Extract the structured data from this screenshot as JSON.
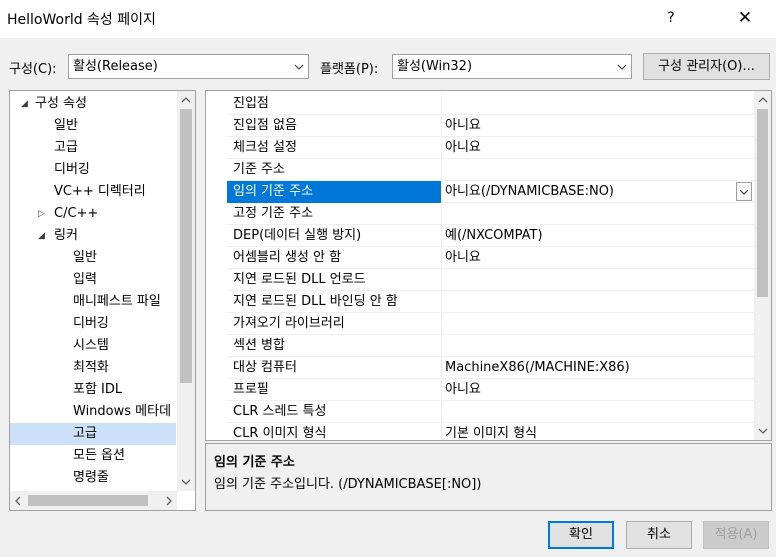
{
  "window": {
    "title": "HelloWorld 속성 페이지",
    "help_label": "?",
    "close_label": "✕"
  },
  "config": {
    "config_label": "구성(C):",
    "config_value": "활성(Release)",
    "platform_label": "플랫폼(P):",
    "platform_value": "활성(Win32)",
    "manager_button": "구성 관리자(O)..."
  },
  "tree": {
    "items": [
      {
        "label": "구성 속성",
        "expander": "◢"
      },
      {
        "label": "일반"
      },
      {
        "label": "고급"
      },
      {
        "label": "디버깅"
      },
      {
        "label": "VC++ 디렉터리"
      },
      {
        "label": "C/C++",
        "expander": "▷"
      },
      {
        "label": "링커",
        "expander": "◢"
      },
      {
        "label": "일반"
      },
      {
        "label": "입력"
      },
      {
        "label": "매니페스트 파일"
      },
      {
        "label": "디버깅"
      },
      {
        "label": "시스템"
      },
      {
        "label": "최적화"
      },
      {
        "label": "포함 IDL"
      },
      {
        "label": "Windows 메타데"
      },
      {
        "label": "고급"
      },
      {
        "label": "모든 옵션"
      },
      {
        "label": "명령줄"
      }
    ],
    "selected_index": 15
  },
  "grid": {
    "rows": [
      {
        "name": "진입점",
        "value": ""
      },
      {
        "name": "진입점 없음",
        "value": "아니요"
      },
      {
        "name": "체크섬 설정",
        "value": "아니요"
      },
      {
        "name": "기준 주소",
        "value": ""
      },
      {
        "name": "임의 기준 주소",
        "value": "아니요(/DYNAMICBASE:NO)"
      },
      {
        "name": "고정 기준 주소",
        "value": ""
      },
      {
        "name": "DEP(데이터 실행 방지)",
        "value": "예(/NXCOMPAT)"
      },
      {
        "name": "어셈블리 생성 안 함",
        "value": "아니요"
      },
      {
        "name": "지연 로드된 DLL 언로드",
        "value": ""
      },
      {
        "name": "지연 로드된 DLL 바인딩 안 함",
        "value": ""
      },
      {
        "name": "가져오기 라이브러리",
        "value": ""
      },
      {
        "name": "섹션 병합",
        "value": ""
      },
      {
        "name": "대상 컴퓨터",
        "value": "MachineX86(/MACHINE:X86)"
      },
      {
        "name": "프로필",
        "value": "아니요"
      },
      {
        "name": "CLR 스레드 특성",
        "value": ""
      },
      {
        "name": "CLR 이미지 형식",
        "value": "기본 이미지 형식"
      }
    ],
    "selected_index": 4
  },
  "description": {
    "title": "임의 기준 주소",
    "text": "임의 기준 주소입니다. (/DYNAMICBASE[:NO])"
  },
  "buttons": {
    "ok": "확인",
    "cancel": "취소",
    "apply": "적용(A)"
  },
  "colors": {
    "selection": "#0078d7",
    "tree_selection": "#cce0f8",
    "ok_border": "#0078d7"
  }
}
